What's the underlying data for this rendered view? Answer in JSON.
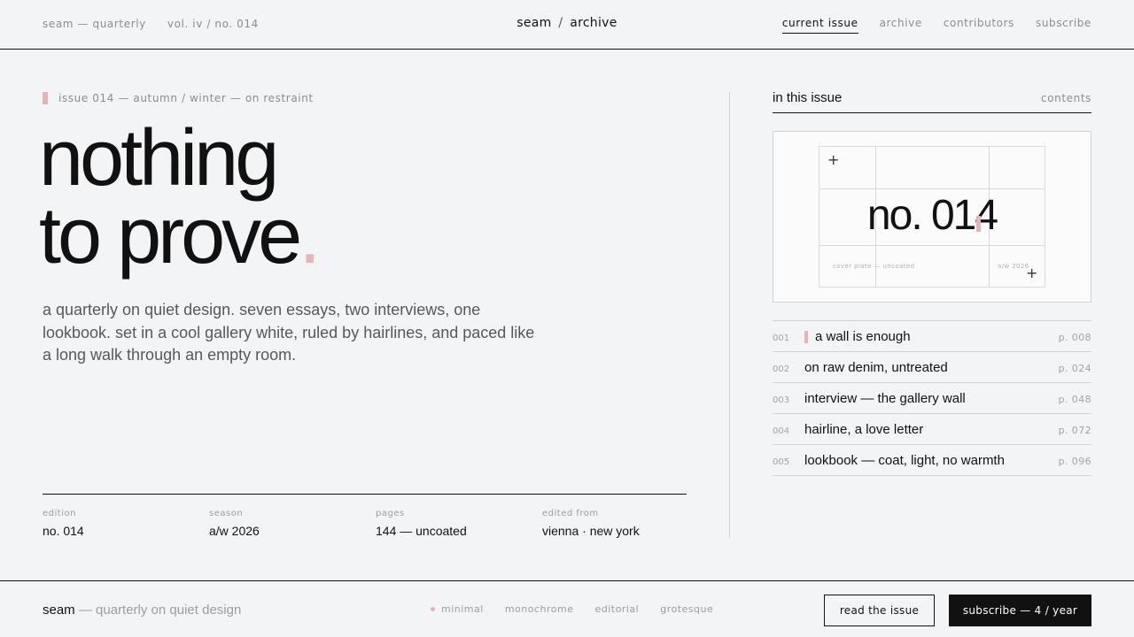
{
  "topbar": {
    "left": [
      "seam — quarterly",
      "vol. iv / no. 014"
    ],
    "title_left": "seam",
    "title_sep": "/",
    "title_right": "archive",
    "nav": [
      "current issue",
      "archive",
      "contributors",
      "subscribe"
    ],
    "active_nav": "current issue"
  },
  "hero": {
    "kicker": "issue 014 — autumn / winter — on restraint",
    "headline_line1": "nothing",
    "headline_line2": "to prove",
    "headline_dot": ".",
    "lede": "a quarterly on quiet design. seven essays, two interviews, one lookbook. set in a cool gallery white, ruled by hairlines, and paced like a long walk through an empty room."
  },
  "meta": [
    {
      "label": "edition",
      "value": "no. 014"
    },
    {
      "label": "season",
      "value": "a/w 2026"
    },
    {
      "label": "pages",
      "value": "144 — uncoated"
    },
    {
      "label": "edited from",
      "value": "vienna · new york"
    }
  ],
  "sidebar": {
    "title": "in this issue",
    "contents_link": "contents",
    "cover": {
      "number": "no. 014",
      "caption_left": "cover plate — uncoated",
      "caption_right": "a/w 2026"
    },
    "toc": [
      {
        "num": "001",
        "title": "a wall is enough",
        "page": "p. 008",
        "marked": true
      },
      {
        "num": "002",
        "title": "on raw denim, untreated",
        "page": "p. 024",
        "marked": false
      },
      {
        "num": "003",
        "title": "interview — the gallery wall",
        "page": "p. 048",
        "marked": false
      },
      {
        "num": "004",
        "title": "hairline, a love letter",
        "page": "p. 072",
        "marked": false
      },
      {
        "num": "005",
        "title": "lookbook — coat, light, no warmth",
        "page": "p. 096",
        "marked": false
      }
    ]
  },
  "footer": {
    "brand": "seam",
    "brand_sub": "— quarterly on quiet design",
    "tags": [
      "minimal",
      "monochrome",
      "editorial",
      "grotesque"
    ],
    "read_button": "read the issue",
    "subscribe_button": "subscribe — 4 / year"
  },
  "colors": {
    "accent": "#e8b3b8",
    "ink": "#111111",
    "paper": "#f3f4f6",
    "muted": "#8a8d92"
  }
}
